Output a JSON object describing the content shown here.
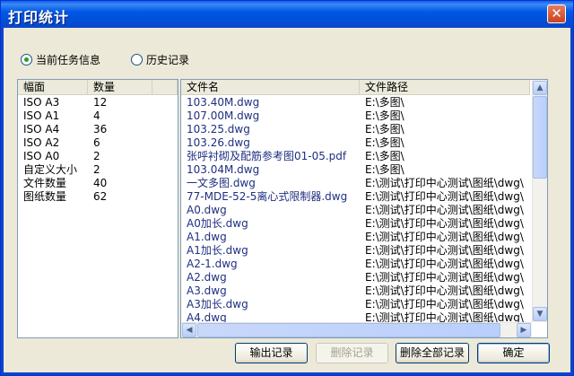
{
  "window": {
    "title": "打印统计",
    "close_symbol": "✕"
  },
  "options": {
    "current": {
      "label": "当前任务信息",
      "selected": true
    },
    "history": {
      "label": "历史记录",
      "selected": false
    }
  },
  "summary": {
    "headers": [
      "幅面",
      "数量"
    ],
    "rows": [
      [
        "ISO A3",
        "12"
      ],
      [
        "ISO A1",
        "4"
      ],
      [
        "ISO A4",
        "36"
      ],
      [
        "ISO A2",
        "6"
      ],
      [
        "ISO A0",
        "2"
      ],
      [
        "自定义大小",
        "2"
      ],
      [
        "文件数量",
        "40"
      ],
      [
        "图纸数量",
        "62"
      ]
    ]
  },
  "files": {
    "headers": [
      "文件名",
      "文件路径"
    ],
    "rows": [
      [
        "103.40M.dwg",
        "E:\\多图\\"
      ],
      [
        "107.00M.dwg",
        "E:\\多图\\"
      ],
      [
        "103.25.dwg",
        "E:\\多图\\"
      ],
      [
        "103.26.dwg",
        "E:\\多图\\"
      ],
      [
        "张呼衬砌及配筋参考图01-05.pdf",
        "E:\\多图\\"
      ],
      [
        "103.04M.dwg",
        "E:\\多图\\"
      ],
      [
        "一文多图.dwg",
        "E:\\测试\\打印中心测试\\图纸\\dwg\\"
      ],
      [
        "77-MDE-52-5离心式限制器.dwg",
        "E:\\测试\\打印中心测试\\图纸\\dwg\\"
      ],
      [
        "A0.dwg",
        "E:\\测试\\打印中心测试\\图纸\\dwg\\"
      ],
      [
        "A0加长.dwg",
        "E:\\测试\\打印中心测试\\图纸\\dwg\\"
      ],
      [
        "A1.dwg",
        "E:\\测试\\打印中心测试\\图纸\\dwg\\"
      ],
      [
        "A1加长.dwg",
        "E:\\测试\\打印中心测试\\图纸\\dwg\\"
      ],
      [
        "A2-1.dwg",
        "E:\\测试\\打印中心测试\\图纸\\dwg\\"
      ],
      [
        "A2.dwg",
        "E:\\测试\\打印中心测试\\图纸\\dwg\\"
      ],
      [
        "A3.dwg",
        "E:\\测试\\打印中心测试\\图纸\\dwg\\"
      ],
      [
        "A3加长.dwg",
        "E:\\测试\\打印中心测试\\图纸\\dwg\\"
      ],
      [
        "A4.dwg",
        "E:\\测试\\打印中心测试\\图纸\\dwg\\"
      ]
    ]
  },
  "scrollbar": {
    "up": "▲",
    "down": "▼",
    "left": "◀",
    "right": "▶"
  },
  "buttons": {
    "export": {
      "label": "输出记录",
      "enabled": true
    },
    "delete": {
      "label": "删除记录",
      "enabled": false
    },
    "delete_all": {
      "label": "删除全部记录",
      "enabled": true
    },
    "ok": {
      "label": "确定",
      "enabled": true
    }
  },
  "colors": {
    "titlebar": "#0058e6",
    "file_name_text": "#1f2f80",
    "disabled_text": "#a4a290"
  }
}
